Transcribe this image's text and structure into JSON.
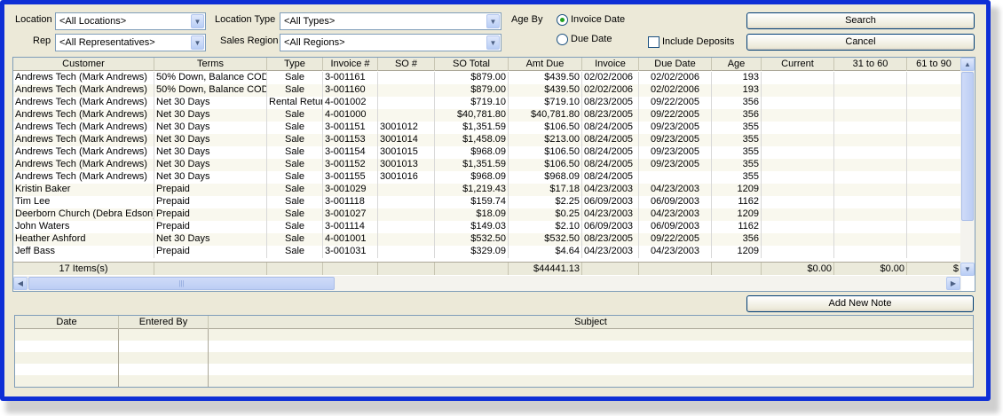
{
  "filters": {
    "location_label": "Location",
    "location_value": "<All Locations>",
    "rep_label": "Rep",
    "rep_value": "<All Representatives>",
    "location_type_label": "Location Type",
    "location_type_value": "<All Types>",
    "sales_region_label": "Sales Region",
    "sales_region_value": "<All Regions>",
    "age_by_label": "Age By",
    "invoice_date_label": "Invoice Date",
    "due_date_label": "Due Date",
    "include_deposits_label": "Include Deposits",
    "age_by_selected": "Invoice Date",
    "include_deposits_checked": false
  },
  "buttons": {
    "search": "Search",
    "cancel": "Cancel",
    "add_note": "Add New Note"
  },
  "grid": {
    "columns": [
      "Customer",
      "Terms",
      "Type",
      "Invoice #",
      "SO #",
      "SO Total",
      "Amt Due",
      "Invoice",
      "Due Date",
      "Age",
      "Current",
      "31 to 60",
      "61 to 90"
    ],
    "rows": [
      [
        "Andrews Tech (Mark Andrews)",
        "50% Down, Balance COD",
        "Sale",
        "3-001161",
        "",
        "$879.00",
        "$439.50",
        "02/02/2006",
        "02/02/2006",
        "193",
        "",
        "",
        ""
      ],
      [
        "Andrews Tech (Mark Andrews)",
        "50% Down, Balance COD",
        "Sale",
        "3-001160",
        "",
        "$879.00",
        "$439.50",
        "02/02/2006",
        "02/02/2006",
        "193",
        "",
        "",
        ""
      ],
      [
        "Andrews Tech (Mark Andrews)",
        "Net 30 Days",
        "Rental Return",
        "4-001002",
        "",
        "$719.10",
        "$719.10",
        "08/23/2005",
        "09/22/2005",
        "356",
        "",
        "",
        ""
      ],
      [
        "Andrews Tech (Mark Andrews)",
        "Net 30 Days",
        "Sale",
        "4-001000",
        "",
        "$40,781.80",
        "$40,781.80",
        "08/23/2005",
        "09/22/2005",
        "356",
        "",
        "",
        ""
      ],
      [
        "Andrews Tech (Mark Andrews)",
        "Net 30 Days",
        "Sale",
        "3-001151",
        "3001012",
        "$1,351.59",
        "$106.50",
        "08/24/2005",
        "09/23/2005",
        "355",
        "",
        "",
        ""
      ],
      [
        "Andrews Tech (Mark Andrews)",
        "Net 30 Days",
        "Sale",
        "3-001153",
        "3001014",
        "$1,458.09",
        "$213.00",
        "08/24/2005",
        "09/23/2005",
        "355",
        "",
        "",
        ""
      ],
      [
        "Andrews Tech (Mark Andrews)",
        "Net 30 Days",
        "Sale",
        "3-001154",
        "3001015",
        "$968.09",
        "$106.50",
        "08/24/2005",
        "09/23/2005",
        "355",
        "",
        "",
        ""
      ],
      [
        "Andrews Tech (Mark Andrews)",
        "Net 30 Days",
        "Sale",
        "3-001152",
        "3001013",
        "$1,351.59",
        "$106.50",
        "08/24/2005",
        "09/23/2005",
        "355",
        "",
        "",
        ""
      ],
      [
        "Andrews Tech (Mark Andrews)",
        "Net 30 Days",
        "Sale",
        "3-001155",
        "3001016",
        "$968.09",
        "$968.09",
        "08/24/2005",
        "",
        "355",
        "",
        "",
        ""
      ],
      [
        "Kristin Baker",
        "Prepaid",
        "Sale",
        "3-001029",
        "",
        "$1,219.43",
        "$17.18",
        "04/23/2003",
        "04/23/2003",
        "1209",
        "",
        "",
        ""
      ],
      [
        "Tim Lee",
        "Prepaid",
        "Sale",
        "3-001118",
        "",
        "$159.74",
        "$2.25",
        "06/09/2003",
        "06/09/2003",
        "1162",
        "",
        "",
        ""
      ],
      [
        "Deerborn Church (Debra Edson)",
        "Prepaid",
        "Sale",
        "3-001027",
        "",
        "$18.09",
        "$0.25",
        "04/23/2003",
        "04/23/2003",
        "1209",
        "",
        "",
        ""
      ],
      [
        "John Waters",
        "Prepaid",
        "Sale",
        "3-001114",
        "",
        "$149.03",
        "$2.10",
        "06/09/2003",
        "06/09/2003",
        "1162",
        "",
        "",
        ""
      ],
      [
        "Heather Ashford",
        "Net 30 Days",
        "Sale",
        "4-001001",
        "",
        "$532.50",
        "$532.50",
        "08/23/2005",
        "09/22/2005",
        "356",
        "",
        "",
        ""
      ],
      [
        "Jeff Bass",
        "Prepaid",
        "Sale",
        "3-001031",
        "",
        "$329.09",
        "$4.64",
        "04/23/2003",
        "04/23/2003",
        "1209",
        "",
        "",
        ""
      ]
    ],
    "totals": {
      "count": "17 Items(s)",
      "amt_due": "$44441.13",
      "current": "$0.00",
      "d31_60": "$0.00",
      "d61_90": "$"
    }
  },
  "notes": {
    "columns": [
      "Date",
      "Entered By",
      "Subject"
    ]
  }
}
